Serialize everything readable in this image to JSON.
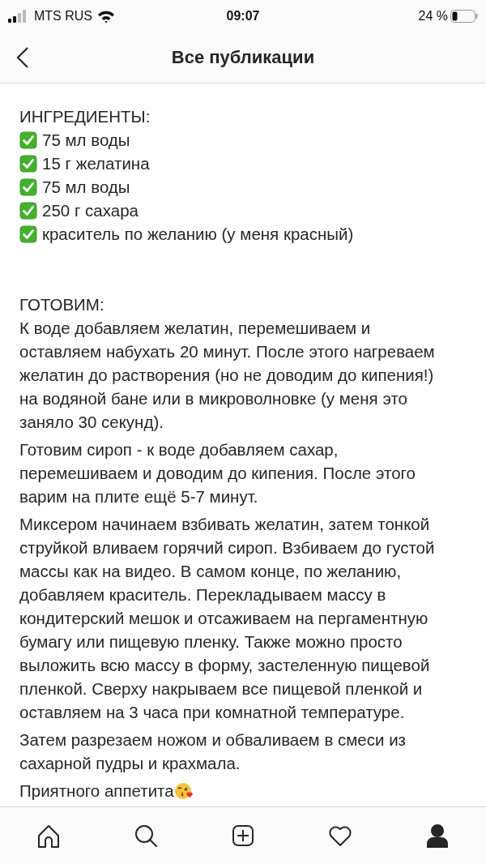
{
  "status_bar": {
    "carrier": "MTS RUS",
    "time": "09:07",
    "battery": "24 %"
  },
  "header": {
    "title": "Все публикации"
  },
  "post": {
    "ingredients_title": "ИНГРЕДИЕНТЫ:",
    "ingredients": [
      {
        "text": "75 мл воды",
        "checked": true
      },
      {
        "text": "15 г желатина",
        "checked": true
      },
      {
        "text": "75 мл воды",
        "checked": true
      },
      {
        "text": "250 г сахара",
        "checked": true
      },
      {
        "text": "краситель по желанию (у меня красный)",
        "checked": true
      }
    ],
    "steps_title": "ГОТОВИМ:",
    "steps": [
      "К воде добавляем желатин, перемешиваем и оставляем набухать 20 минут. После этого нагреваем желатин до растворения (но не доводим до кипения!) на водяной бане или в микроволновке (у меня это заняло 30 секунд).",
      "Готовим сироп - к воде добавляем сахар, перемешиваем и доводим до кипения. После этого варим на плите ещё 5-7 минут.",
      "Миксером начинаем взбивать желатин, затем тонкой струйкой вливаем горячий сироп. Взбиваем до густой массы как на видео. В самом конце, по желанию, добавляем краситель. Перекладываем массу в кондитерский мешок и отсаживаем на пергаментную бумагу или пищевую пленку. Также можно просто выложить всю массу в форму, застеленную пищевой пленкой. Сверху накрываем все пищевой пленкой и оставляем на 3 часа при комнатной температуре.",
      "Затем разрезаем ножом и обваливаем в смеси из сахарной пудры и крахмала."
    ],
    "closing": "Приятного аппетита"
  },
  "tab_bar": [
    {
      "kind": "home"
    },
    {
      "kind": "search"
    },
    {
      "kind": "add"
    },
    {
      "kind": "heart"
    },
    {
      "kind": "profile"
    }
  ]
}
